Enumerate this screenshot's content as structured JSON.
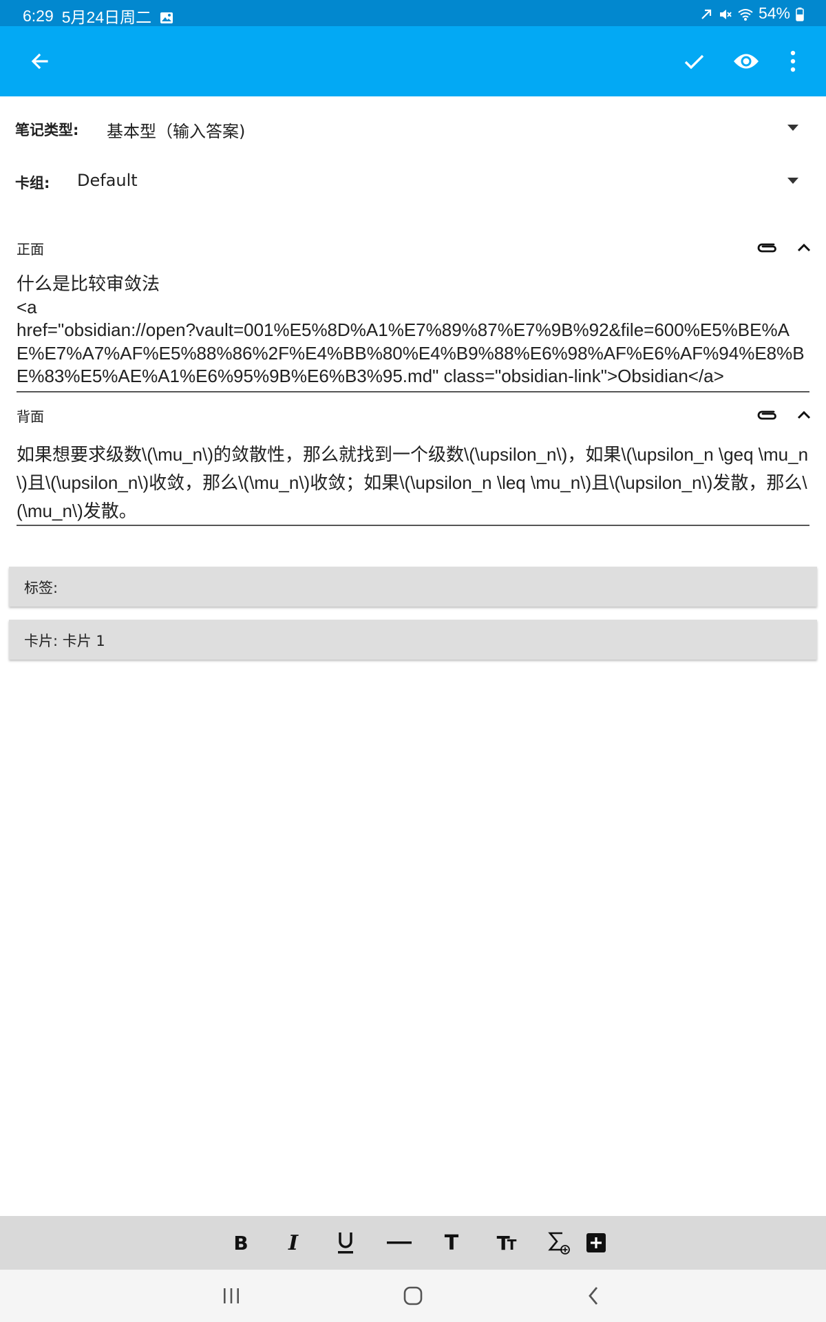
{
  "status_bar": {
    "time": "6:29",
    "date": "5月24日周二",
    "battery": "54%",
    "icons": [
      "gallery-icon",
      "sync-icon",
      "mute-icon",
      "wifi-icon",
      "battery-icon"
    ]
  },
  "app_bar": {
    "background_color": "#03a9f4",
    "actions": [
      "back-arrow-icon",
      "checkmark-icon",
      "preview-eye-icon",
      "more-vert-icon"
    ]
  },
  "note_type": {
    "label": "笔记类型:",
    "value": "基本型（输入答案)"
  },
  "deck": {
    "label": "卡组:",
    "value": "Default"
  },
  "fields": [
    {
      "name": "正面",
      "content": "什么是比较审敛法\n<a\nhref=\"obsidian://open?vault=001%E5%8D%A1%E7%89%87%E7%9B%92&file=600%E5%BE%AE%E7%A7%AF%E5%88%86%2F%E4%BB%80%E4%B9%88%E6%98%AF%E6%AF%94%E8%BE%83%E5%AE%A1%E6%95%9B%E6%B3%95.md\" class=\"obsidian-link\">Obsidian</a>"
    },
    {
      "name": "背面",
      "content": "如果想要求级数\\(\\mu_n\\)的敛散性，那么就找到一个级数\\(\\upsilon_n\\)，如果\\(\\upsilon_n \\geq \\mu_n\\)且\\(\\upsilon_n\\)收敛，那么\\(\\mu_n\\)收敛；如果\\(\\upsilon_n \\leq \\mu_n\\)且\\(\\upsilon_n\\)发散，那么\\(\\mu_n\\)发散。"
    }
  ],
  "tags": {
    "label": "标签:"
  },
  "cards": {
    "label": "卡片: 卡片 1"
  },
  "format_toolbar": [
    "bold-icon",
    "italic-icon",
    "underline-icon",
    "horizontal-rule-icon",
    "text-size-icon",
    "font-size-icon",
    "math-sigma-icon",
    "add-box-icon"
  ],
  "nav_bar": [
    "recent-apps-icon",
    "home-icon",
    "back-icon"
  ]
}
